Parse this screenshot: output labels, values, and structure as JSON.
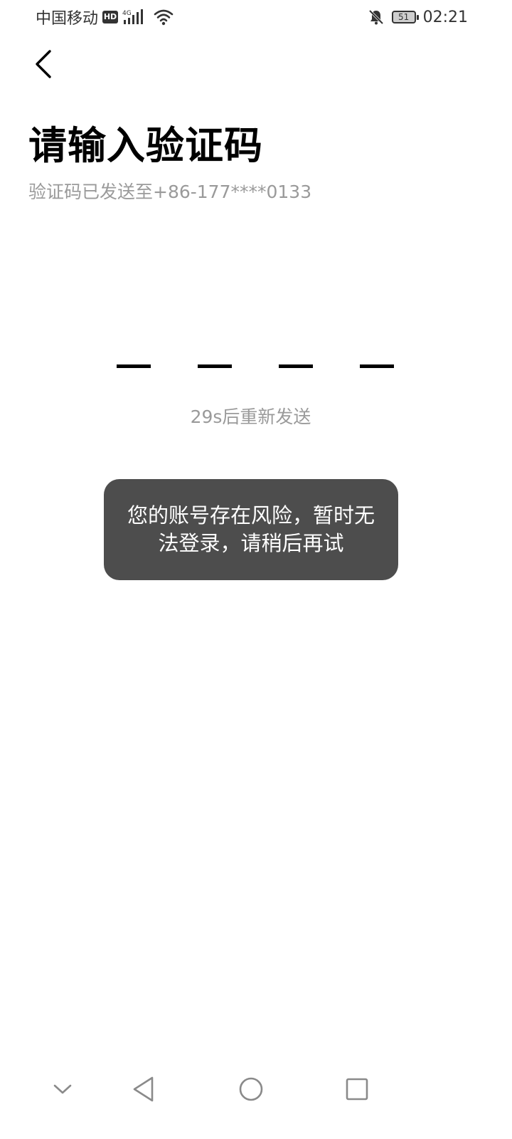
{
  "status_bar": {
    "carrier": "中国移动",
    "hd_label": "HD",
    "network": "4G",
    "battery_level": "51",
    "time": "02:21",
    "icons": [
      "hd-icon",
      "signal-icon",
      "wifi-icon",
      "mute-bell-icon",
      "battery-icon"
    ]
  },
  "header": {
    "back_icon": "chevron-left-icon"
  },
  "main": {
    "title": "请输入验证码",
    "subtitle": "验证码已发送至+86-177****0133",
    "code_slots": 4,
    "resend_text": "29s后重新发送"
  },
  "toast": {
    "message": "您的账号存在风险，暂时无法登录，请稍后再试"
  },
  "nav_bar": {
    "buttons": [
      "chevron-down-icon",
      "back-triangle-icon",
      "home-circle-icon",
      "recents-square-icon"
    ]
  },
  "colors": {
    "background": "#ffffff",
    "title": "#000000",
    "muted_text": "#9a9a9a",
    "toast_bg": "#4d4d4d",
    "toast_text": "#ffffff"
  }
}
